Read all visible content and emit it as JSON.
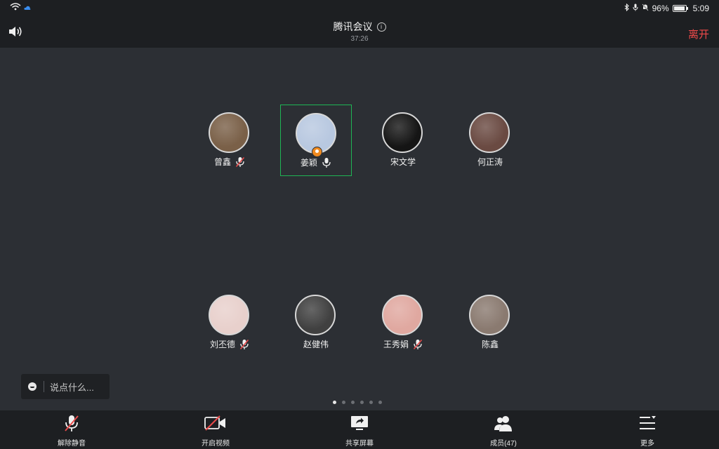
{
  "status_bar": {
    "battery": "96%",
    "time": "5:09",
    "battery_level": 0.96
  },
  "header": {
    "title": "腾讯会议",
    "timer": "37:26",
    "leave_label": "离开"
  },
  "participants": [
    {
      "name": "曾鑫",
      "muted": true,
      "avatar_color": "#7a6048"
    },
    {
      "name": "姜颖",
      "muted": false,
      "host": true,
      "active": true,
      "avatar_color": "#b8c8e0"
    },
    {
      "name": "宋文学",
      "avatar_color": "#151515"
    },
    {
      "name": "何正涛",
      "avatar_color": "#6a4a42"
    },
    {
      "name": "刘丕德",
      "muted": true,
      "avatar_color": "#e8d0cc"
    },
    {
      "name": "赵健伟",
      "avatar_color": "#404040"
    },
    {
      "name": "王秀娟",
      "muted": true,
      "avatar_color": "#e0a8a0"
    },
    {
      "name": "陈鑫",
      "avatar_color": "#8a7a70"
    }
  ],
  "pagination": {
    "pages": 6,
    "current": 1
  },
  "chat": {
    "placeholder": "说点什么..."
  },
  "toolbar": {
    "unmute_label": "解除静音",
    "video_label": "开启视频",
    "share_label": "共享屏幕",
    "members_label": "成员(47)",
    "more_label": "更多"
  }
}
